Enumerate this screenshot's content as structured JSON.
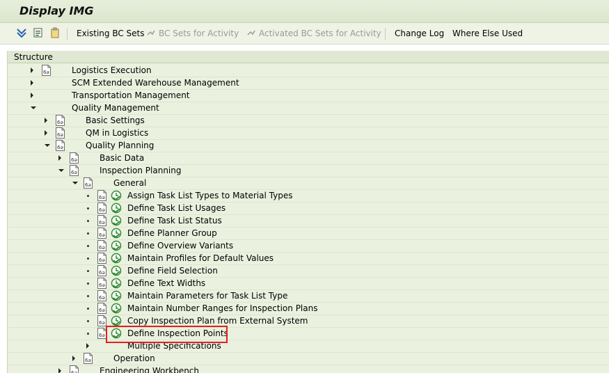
{
  "window": {
    "title": "Display IMG"
  },
  "toolbar": {
    "existing_bc_sets": "Existing BC Sets",
    "bc_sets_for_activity": "BC Sets for Activity",
    "activated_bc_sets": "Activated BC Sets for Activity",
    "change_log": "Change Log",
    "where_else_used": "Where Else Used"
  },
  "tree": {
    "header": "Structure",
    "rows": [
      {
        "label": "Logistics Execution",
        "expander": "closed",
        "doc": true,
        "clock": false
      },
      {
        "label": "SCM Extended Warehouse Management",
        "expander": "closed",
        "doc": false,
        "clock": false
      },
      {
        "label": "Transportation Management",
        "expander": "closed",
        "doc": false,
        "clock": false
      },
      {
        "label": "Quality Management",
        "expander": "open",
        "doc": false,
        "clock": false
      },
      {
        "label": "Basic Settings",
        "expander": "closed",
        "doc": true,
        "clock": false
      },
      {
        "label": "QM in Logistics",
        "expander": "closed",
        "doc": true,
        "clock": false
      },
      {
        "label": "Quality Planning",
        "expander": "open",
        "doc": true,
        "clock": false
      },
      {
        "label": "Basic Data",
        "expander": "closed",
        "doc": true,
        "clock": false
      },
      {
        "label": "Inspection Planning",
        "expander": "open",
        "doc": true,
        "clock": false
      },
      {
        "label": "General",
        "expander": "open",
        "doc": true,
        "clock": false
      },
      {
        "label": "Assign Task List Types to Material Types",
        "expander": "bullet",
        "doc": true,
        "clock": true
      },
      {
        "label": "Define Task List Usages",
        "expander": "bullet",
        "doc": true,
        "clock": true
      },
      {
        "label": "Define Task List Status",
        "expander": "bullet",
        "doc": true,
        "clock": true
      },
      {
        "label": "Define Planner Group",
        "expander": "bullet",
        "doc": true,
        "clock": true
      },
      {
        "label": "Define Overview Variants",
        "expander": "bullet",
        "doc": true,
        "clock": true
      },
      {
        "label": "Maintain Profiles for Default Values",
        "expander": "bullet",
        "doc": true,
        "clock": true
      },
      {
        "label": "Define Field Selection",
        "expander": "bullet",
        "doc": true,
        "clock": true
      },
      {
        "label": "Define Text Widths",
        "expander": "bullet",
        "doc": true,
        "clock": true
      },
      {
        "label": "Maintain Parameters for Task List Type",
        "expander": "bullet",
        "doc": true,
        "clock": true
      },
      {
        "label": "Maintain Number Ranges for Inspection Plans",
        "expander": "bullet",
        "doc": true,
        "clock": true
      },
      {
        "label": "Copy Inspection Plan from External System",
        "expander": "bullet",
        "doc": true,
        "clock": true
      },
      {
        "label": "Define Inspection Points",
        "expander": "bullet",
        "doc": true,
        "clock": true
      },
      {
        "label": "Multiple Specifications",
        "expander": "closed",
        "doc": false,
        "clock": false
      },
      {
        "label": "Operation",
        "expander": "closed",
        "doc": true,
        "clock": false
      },
      {
        "label": "Engineering Workbench",
        "expander": "closed",
        "doc": true,
        "clock": false
      }
    ]
  },
  "colors": {
    "tree_bg": "#eaf1df",
    "highlight": "#e0201e",
    "clock_green": "#2e8b2e"
  }
}
